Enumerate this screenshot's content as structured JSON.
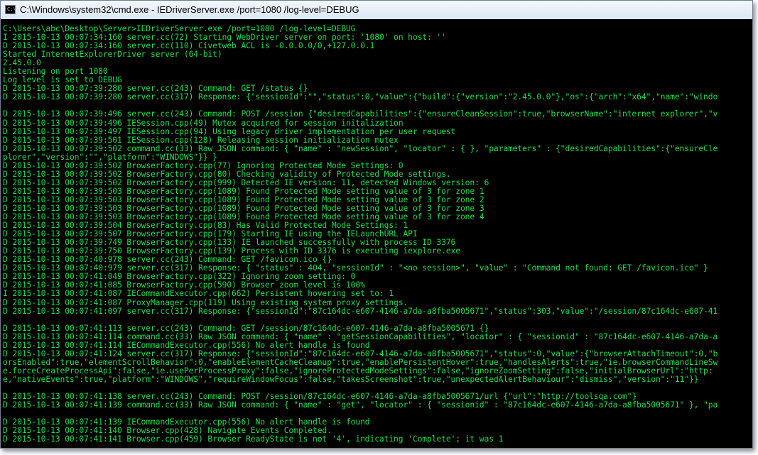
{
  "window": {
    "title": "C:\\Windows\\system32\\cmd.exe - IEDriverServer.exe  /port=1080 /log-level=DEBUG",
    "icon": "cmd-icon",
    "icon_glyph": "C:\\",
    "text_color": "#18e04b",
    "background": "#000000"
  },
  "console": {
    "lines": [
      "C:\\Users\\abc\\Desktop\\Server>IEDriverServer.exe /port=1080 /log-level=DEBUG",
      "I 2015-10-13 00:07:34:160 server.cc(72) Starting WebDriver server on port: '1080' on host: ''",
      "D 2015-10-13 00:07:34:160 server.cc(110) Civetweb ACL is -0.0.0.0/0,+127.0.0.1",
      "Started InternetExplorerDriver server (64-bit)",
      "2.45.0.0",
      "Listening on port 1080",
      "Log level is set to DEBUG",
      "D 2015-10-13 00:07:39:280 server.cc(243) Command: GET /status {}",
      "D 2015-10-13 00:07:39:280 server.cc(317) Response: {\"sessionId\":\"\",\"status\":0,\"value\":{\"build\":{\"version\":\"2.45.0.0\"},\"os\":{\"arch\":\"x64\",\"name\":\"windo",
      "",
      "D 2015-10-13 00:07:39:496 server.cc(243) Command: POST /session {\"desiredCapabilities\":{\"ensureCleanSession\":true,\"browserName\":\"internet explorer\",\"v",
      "D 2015-10-13 00:07:39:496 IESession.cpp(49) Mutex acquired for session initalization",
      "D 2015-10-13 00:07:39:497 IESession.cpp(94) Using legacy driver implementation per user request",
      "D 2015-10-13 00:07:39:501 IESession.cpp(128) Releasing session initialization mutex",
      "D 2015-10-13 00:07:39:502 command.cc(33) Raw JSON command: { \"name\" : \"newSession\", \"locator\" : { }, \"parameters\" : {\"desiredCapabilities\":{\"ensureCle",
      "plorer\",\"version\":\"\",\"platform\":\"WINDOWS\"}} }",
      "D 2015-10-13 00:07:39:502 BrowserFactory.cpp(77) Ignoring Protected Mode Settings: 0",
      "D 2015-10-13 00:07:39:502 BrowserFactory.cpp(80) Checking validity of Protected Mode settings.",
      "D 2015-10-13 00:07:39:502 BrowserFactory.cpp(999) Detected IE version: 11, detected Windows version: 6",
      "D 2015-10-13 00:07:39:503 BrowserFactory.cpp(1089) Found Protected Mode setting value of 3 for zone 1",
      "D 2015-10-13 00:07:39:503 BrowserFactory.cpp(1089) Found Protected Mode setting value of 3 for zone 2",
      "D 2015-10-13 00:07:39:503 BrowserFactory.cpp(1089) Found Protected Mode setting value of 3 for zone 3",
      "D 2015-10-13 00:07:39:503 BrowserFactory.cpp(1089) Found Protected Mode setting value of 3 for zone 4",
      "D 2015-10-13 00:07:39:504 BrowserFactory.cpp(83) Has Valid Protected Mode Settings: 1",
      "D 2015-10-13 00:07:39:507 BrowserFactory.cpp(179) Starting IE using the IELaunchURL API",
      "D 2015-10-13 00:07:39:749 BrowserFactory.cpp(133) IE launched successfully with process ID 3376",
      "D 2015-10-13 00:07:39:750 BrowserFactory.cpp(139) Process with ID 3376 is executing iexplore.exe",
      "D 2015-10-13 00:07:40:978 server.cc(243) Command: GET /favicon.ico {}",
      "D 2015-10-13 00:07:40:979 server.cc(317) Response: { \"status\" : 404, \"sessionId\" : \"<no session>\", \"value\" : \"Command not found: GET /favicon.ico\" }",
      "D 2015-10-13 00:07:41:049 BrowserFactory.cpp(322) Ignoring zoom setting: 0",
      "D 2015-10-13 00:07:41:085 BrowserFactory.cpp(590) Browser zoom level is 100%",
      "I 2015-10-13 00:07:41:087 IECommandExecutor.cpp(662) Persistent hovering set to: 1",
      "D 2015-10-13 00:07:41:087 ProxyManager.cpp(119) Using existing system proxy settings.",
      "D 2015-10-13 00:07:41:097 server.cc(317) Response: {\"sessionId\":\"87c164dc-e607-4146-a7da-a8fba5005671\",\"status\":303,\"value\":\"/session/87c164dc-e607-41",
      "",
      "D 2015-10-13 00:07:41:113 server.cc(243) Command: GET /session/87c164dc-e607-4146-a7da-a8fba5005671 {}",
      "D 2015-10-13 00:07:41:114 command.cc(33) Raw JSON command: { \"name\" : \"getSessionCapabilities\", \"locator\" : { \"sessionid\" : \"87c164dc-e607-4146-a7da-a",
      "D 2015-10-13 00:07:41:114 IECommandExecutor.cpp(556) No alert handle is found",
      "D 2015-10-13 00:07:41:124 server.cc(317) Response: {\"sessionId\":\"87c164dc-e607-4146-a7da-a8fba5005671\",\"status\":0,\"value\":{\"browserAttachTimeout\":0,\"b",
      "orsEnabled\":true,\"elementScrollBehavior\":0,\"enableElementCacheCleanup\":true,\"enablePersistentHover\":true,\"handlesAlerts\":true,\"ie.browserCommandLineSw",
      "e.forceCreateProcessApi\":false,\"ie.usePerProcessProxy\":false,\"ignoreProtectedModeSettings\":false,\"ignoreZoomSetting\":false,\"initialBrowserUrl\":\"http:",
      "e,\"nativeEvents\":true,\"platform\":\"WINDOWS\",\"requireWindowFocus\":false,\"takesScreenshot\":true,\"unexpectedAlertBehaviour\":\"dismiss\",\"version\":\"11\"}}",
      "",
      "D 2015-10-13 00:07:41:138 server.cc(243) Command: POST /session/87c164dc-e607-4146-a7da-a8fba5005671/url {\"url\":\"http://toolsqa.com\"}",
      "D 2015-10-13 00:07:41:139 command.cc(33) Raw JSON command: { \"name\" : \"get\", \"locator\" : { \"sessionid\" : \"87c164dc-e607-4146-a7da-a8fba5005671\" }, \"pa",
      "",
      "D 2015-10-13 00:07:41:139 IECommandExecutor.cpp(556) No alert handle is found",
      "D 2015-10-13 00:07:41:140 Browser.cpp(428) Navigate Events Completed.",
      "D 2015-10-13 00:07:41:141 Browser.cpp(459) Browser ReadyState is not '4', indicating 'Complete'; it was 1"
    ]
  }
}
